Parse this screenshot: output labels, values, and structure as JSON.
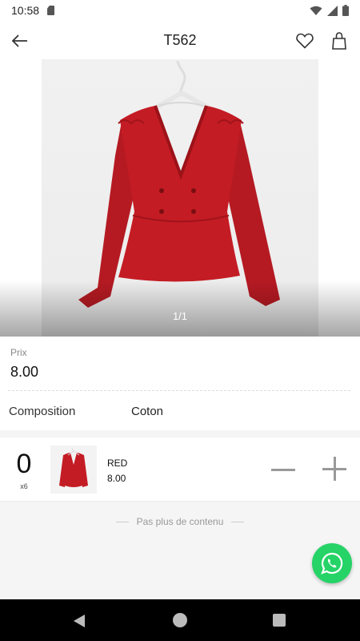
{
  "status_bar": {
    "time": "10:58"
  },
  "app_bar": {
    "title": "T562"
  },
  "gallery": {
    "counter": "1/1"
  },
  "product": {
    "price_label": "Prix",
    "price": "8.00",
    "composition_label": "Composition",
    "composition_value": "Coton"
  },
  "variant": {
    "quantity": "0",
    "pack": "x6",
    "color": "RED",
    "price": "8.00"
  },
  "footer": {
    "end_text": "Pas plus de contenu"
  },
  "colors": {
    "product_red": "#c41c24",
    "whatsapp_green": "#25d366"
  }
}
